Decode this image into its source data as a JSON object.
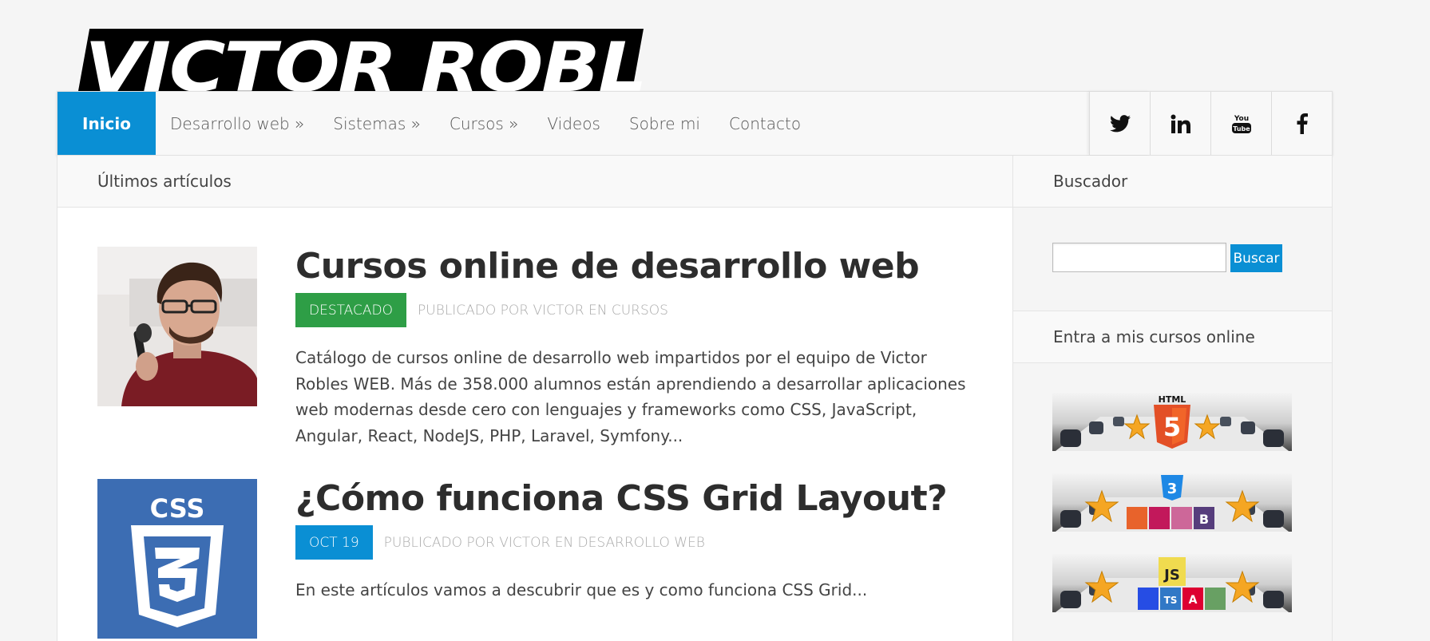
{
  "site": {
    "logo_text": "VICTOR ROBLES"
  },
  "nav": {
    "items": [
      {
        "label": "Inicio",
        "active": true
      },
      {
        "label": "Desarrollo web »"
      },
      {
        "label": "Sistemas »"
      },
      {
        "label": "Cursos »"
      },
      {
        "label": "Videos"
      },
      {
        "label": "Sobre mi"
      },
      {
        "label": "Contacto"
      }
    ],
    "social": [
      {
        "icon": "twitter-icon"
      },
      {
        "icon": "linkedin-icon"
      },
      {
        "icon": "youtube-icon",
        "label": "You Tube"
      },
      {
        "icon": "facebook-icon"
      }
    ]
  },
  "main": {
    "section_title": "Últimos artículos",
    "posts": [
      {
        "title": "Cursos online de desarrollo web",
        "tag": "DESTACADO",
        "tag_color": "#2e9e46",
        "byline": "PUBLICADO POR VICTOR EN CURSOS",
        "excerpt": "Catálogo de cursos online de desarrollo web impartidos por el equipo de Victor Robles WEB. Más de 358.000 alumnos están aprendiendo a desarrollar aplicaciones web modernas desde cero con lenguajes y frameworks como CSS, JavaScript, Angular, React, NodeJS, PHP, Laravel, Symfony..."
      },
      {
        "title": "¿Cómo funciona CSS Grid Layout?",
        "tag": "OCT 19",
        "tag_color": "#0a8fd4",
        "byline": "PUBLICADO POR VICTOR EN DESARROLLO WEB",
        "excerpt": "En este artículos vamos a descubrir que es y como funciona CSS Grid...",
        "thumb_label": "CSS"
      }
    ]
  },
  "sidebar": {
    "search_title": "Buscador",
    "search_value": "",
    "search_button": "Buscar",
    "courses_title": "Entra a mis cursos online",
    "banners": [
      {
        "label": "HTML",
        "badge": "5"
      },
      {
        "badge": "3",
        "tiles": [
          "B"
        ]
      },
      {
        "label": "JS",
        "tiles": [
          "TS",
          "A"
        ]
      }
    ]
  },
  "colors": {
    "accent": "#0a8fd4",
    "featured": "#2e9e46"
  }
}
